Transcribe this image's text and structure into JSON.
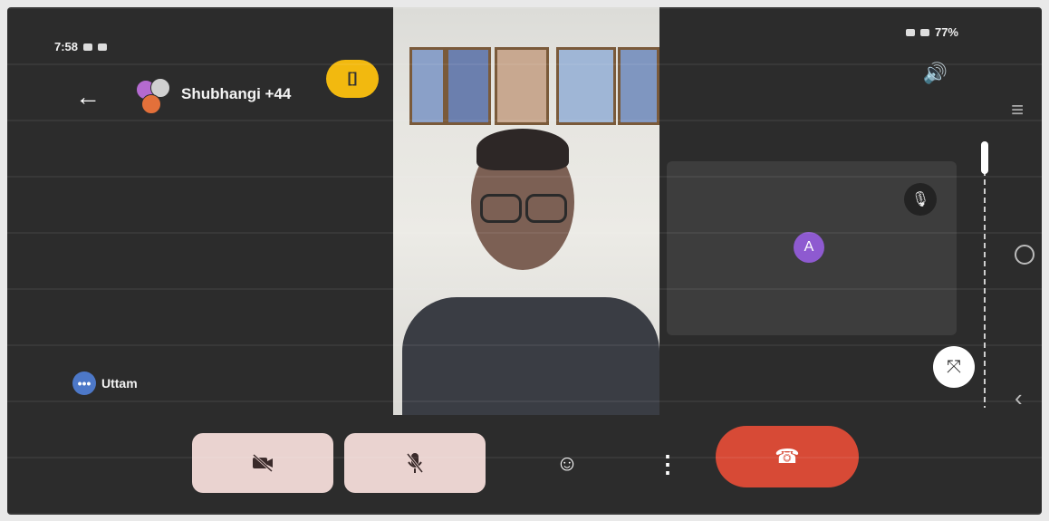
{
  "status_bar": {
    "time": "7:58",
    "battery": "77%"
  },
  "header": {
    "meeting_title": "Shubhangi +44",
    "mirror_badge": "[]"
  },
  "participant_tile": {
    "avatar_letter": "A"
  },
  "self_view": {
    "name": "Uttam",
    "icon_glyph": "•••"
  },
  "controls": {
    "camera_icon": "camera-off-icon",
    "mic_icon": "mic-off-icon",
    "emoji_glyph": "☺",
    "more_glyph": "⋮",
    "end_call_glyph": "☎"
  },
  "colors": {
    "end_call": "#d74a36",
    "mirror_badge": "#f2b90f",
    "participant_avatar": "#8e5ad0",
    "self_icon": "#4d78c8"
  }
}
